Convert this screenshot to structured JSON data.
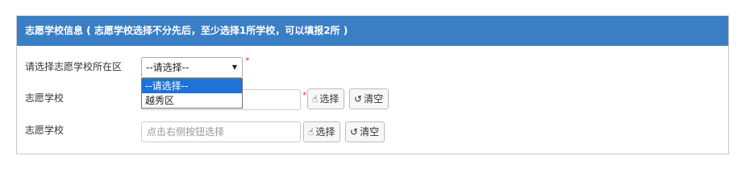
{
  "panel": {
    "title": "志愿学校信息 ( 志愿学校选择不分先后，至少选择1所学校，可以填报2所 )"
  },
  "district": {
    "label": "请选择志愿学校所在区",
    "selected": "--请选择--",
    "required_mark": "*",
    "options": [
      "--请选择--",
      "越秀区"
    ]
  },
  "school1": {
    "label": "志愿学校",
    "placeholder": "点击右侧按钮选择",
    "required_mark": "*",
    "select_button": "选择",
    "clear_button": "清空"
  },
  "school2": {
    "label": "志愿学校",
    "placeholder": "点击右侧按钮选择",
    "select_button": "选择",
    "clear_button": "清空"
  },
  "icons": {
    "select": "pointing-hand-icon",
    "clear": "undo-icon"
  }
}
